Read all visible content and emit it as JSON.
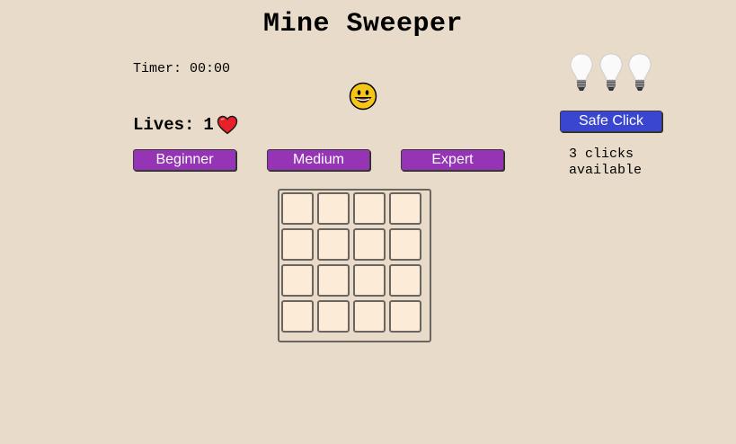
{
  "title": "Mine Sweeper",
  "timer": {
    "label": "Timer:",
    "value": "00:00"
  },
  "status_face": {
    "icon": "smiley-face-icon",
    "color": "#f5c518"
  },
  "lives": {
    "label": "Lives:",
    "count": "1",
    "icon": "heart-icon",
    "color": "#e8202a"
  },
  "hints": {
    "count": 3,
    "icon": "lightbulb-icon"
  },
  "difficulty": {
    "beginner_label": "Beginner",
    "medium_label": "Medium",
    "expert_label": "Expert",
    "color": "#9535b5"
  },
  "safe_click": {
    "label": "Safe Click",
    "color": "#3a46cf",
    "available_text": "3 clicks available"
  },
  "board": {
    "rows": 4,
    "cols": 4,
    "cell_color": "#fbebd7"
  }
}
